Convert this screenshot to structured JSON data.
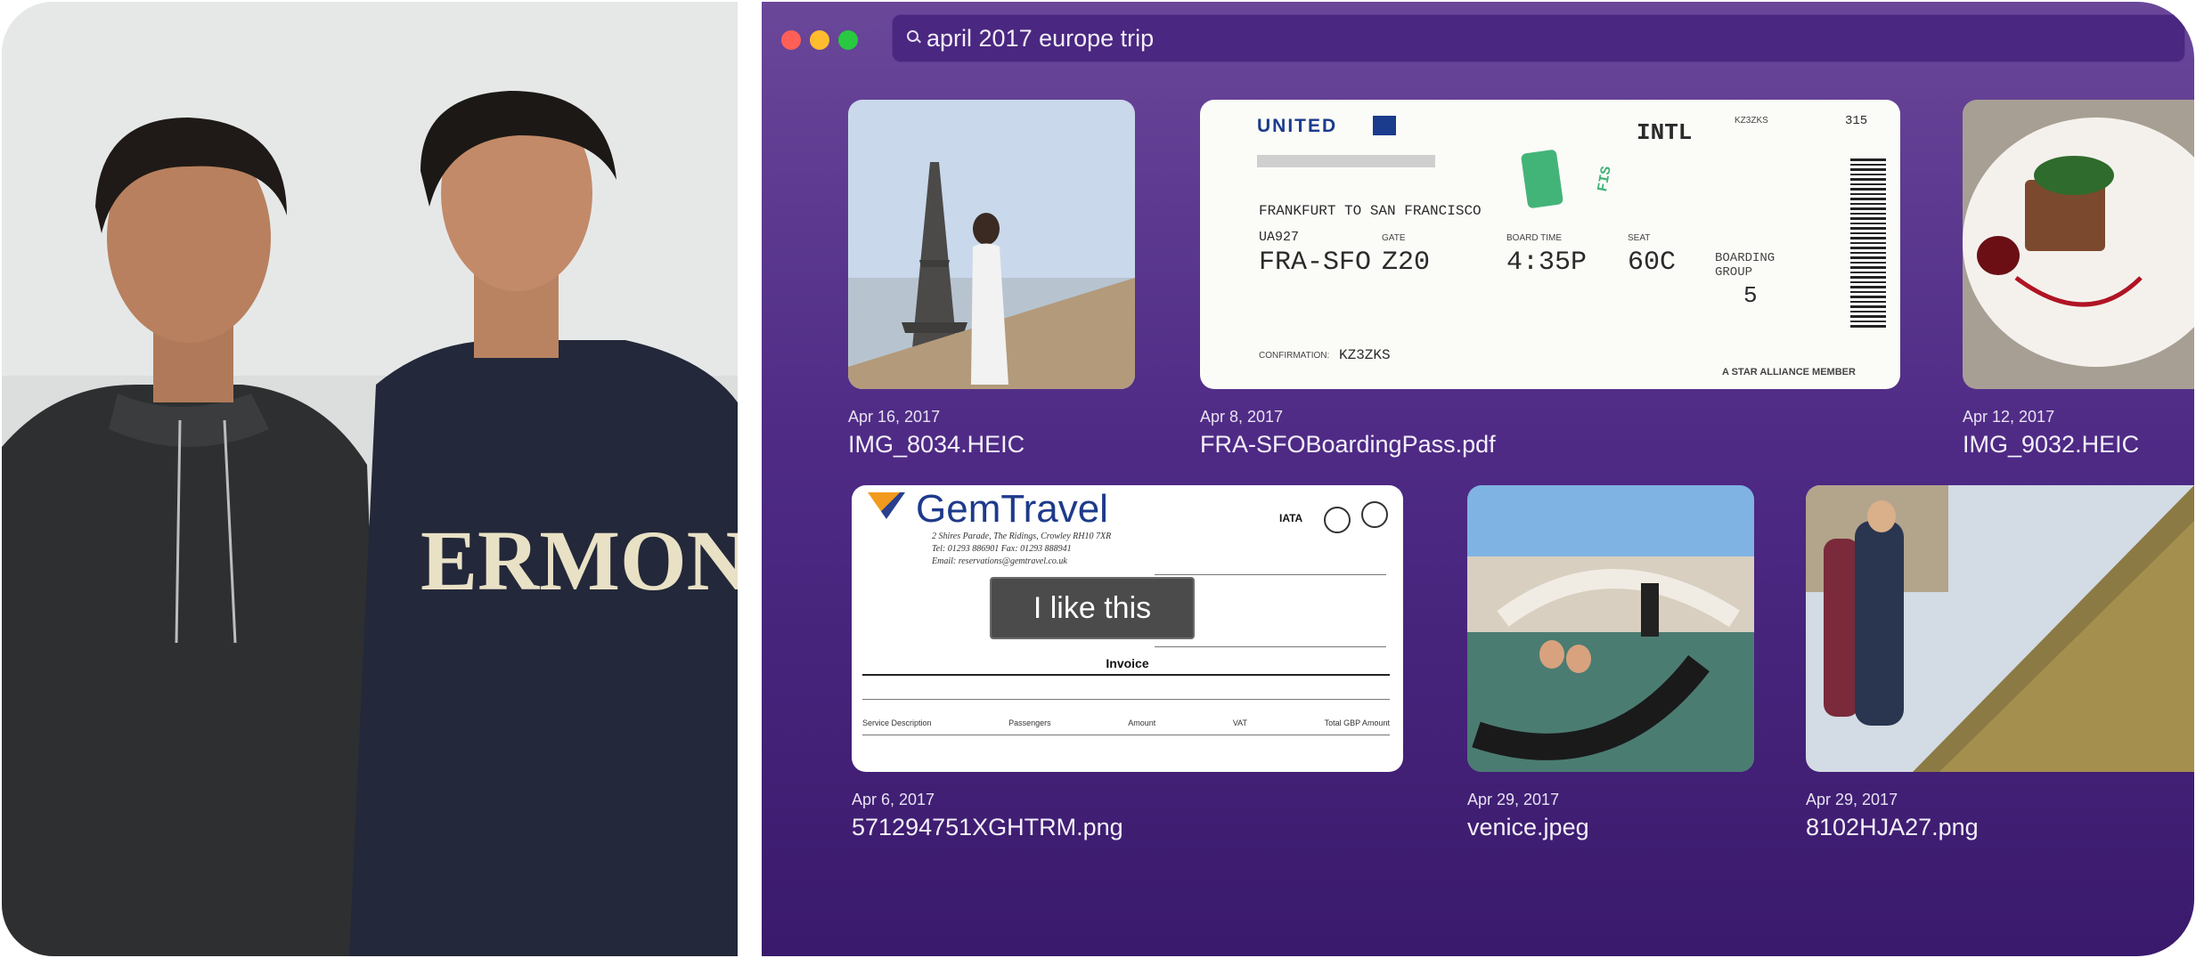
{
  "search": {
    "query": "april 2017 europe trip"
  },
  "photo_left": {
    "sweatshirt_text": "ERMONT"
  },
  "results": [
    {
      "date": "Apr 16, 2017",
      "name": "IMG_8034.HEIC"
    },
    {
      "date": "Apr 8, 2017",
      "name": "FRA-SFOBoardingPass.pdf"
    },
    {
      "date": "Apr 12, 2017",
      "name": "IMG_9032.HEIC"
    },
    {
      "date": "Apr 6, 2017",
      "name": "571294751XGHTRM.png"
    },
    {
      "date": "Apr 29, 2017",
      "name": "venice.jpeg"
    },
    {
      "date": "Apr 29, 2017",
      "name": "8102HJA27.png"
    }
  ],
  "boarding_pass": {
    "airline": "UNITED",
    "class": "INTL",
    "code_top": "KZ3ZKS",
    "num_top": "315",
    "route_text": "FRANKFURT TO SAN FRANCISCO",
    "flight": "UA927",
    "route_code": "FRA-SFO",
    "gate_label": "GATE",
    "gate": "Z20",
    "boarding_time_label": "BOARD TIME",
    "boarding_time": "4:35P",
    "seat_label": "SEAT",
    "seat": "60C",
    "group_label": "BOARDING GROUP",
    "group": "5",
    "confirmation_label": "CONFIRMATION:",
    "confirmation": "KZ3ZKS",
    "stamp": "FIS",
    "alliance": "A STAR ALLIANCE MEMBER"
  },
  "invoice": {
    "brand": "GemTravel",
    "address": "2 Shires Parade, The Ridings, Crowley RH10 7XR",
    "phone": "Tel: 01293 886901  Fax: 01293 888941",
    "email": "Email: reservations@gemtravel.co.uk",
    "title": "Invoice",
    "iata": "IATA",
    "table_headers": [
      "Service Description",
      "Passengers",
      "Amount",
      "VAT",
      "Total GBP Amount"
    ]
  },
  "tooltip": "I like this",
  "colors": {
    "window_top": "#6a4799",
    "window_bottom": "#3a1a6c",
    "close": "#ff5f57",
    "minimize": "#febc2e",
    "zoom": "#28c840"
  }
}
